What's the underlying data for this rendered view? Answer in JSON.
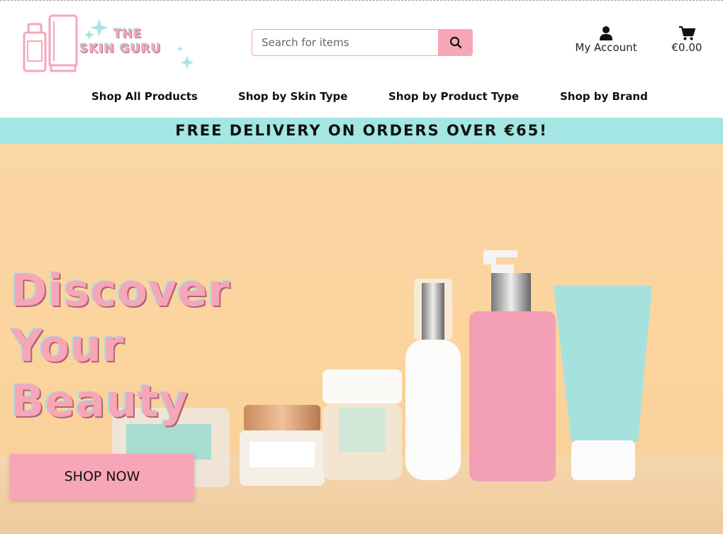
{
  "brand": {
    "line1": "THE",
    "line2": "SKIN GURU"
  },
  "search": {
    "placeholder": "Search for items"
  },
  "account": {
    "label": "My Account"
  },
  "cart": {
    "total": "€0.00"
  },
  "nav": {
    "items": [
      {
        "label": "Shop All Products"
      },
      {
        "label": "Shop by Skin Type"
      },
      {
        "label": "Shop by Product Type"
      },
      {
        "label": "Shop by Brand"
      }
    ]
  },
  "promo": {
    "text": "FREE DELIVERY ON ORDERS OVER €65!"
  },
  "hero": {
    "title_lines": [
      "Discover",
      "Your",
      "Beauty"
    ],
    "cta_label": "SHOP NOW"
  },
  "colors": {
    "accent_pink": "#f7a6b8",
    "accent_teal": "#a3e6e3",
    "hero_bg": "#fbd7a6"
  },
  "icons": [
    "search-icon",
    "user-icon",
    "cart-icon"
  ]
}
